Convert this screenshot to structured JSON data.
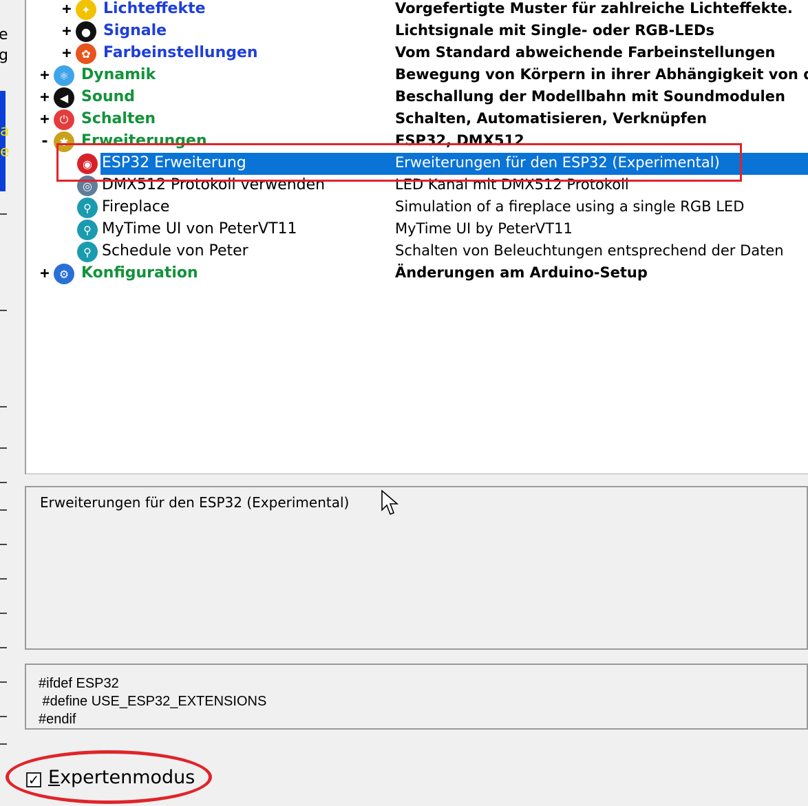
{
  "left_fragments": [
    "e",
    "g",
    "a",
    "e"
  ],
  "tree": {
    "rows": [
      {
        "expander": "+",
        "icon": "light-bulb-icon",
        "icon_color": "#f2c200",
        "icon_glyph": "✦",
        "name": "Lichteffekte",
        "name_style": "cat-blue",
        "desc": "Vorgefertigte Muster für zahlreiche Lichteffekte.",
        "desc_style": "bold-desc"
      },
      {
        "expander": "+",
        "icon": "signal-icon",
        "icon_color": "#111111",
        "icon_glyph": "●",
        "name": "Signale",
        "name_style": "cat-blue",
        "desc": "Lichtsignale mit Single- oder RGB-LEDs",
        "desc_style": "bold-desc"
      },
      {
        "expander": "+",
        "icon": "color-wheel-icon",
        "icon_color": "#e8541c",
        "icon_glyph": "✿",
        "name": "Farbeinstellungen",
        "name_style": "cat-blue",
        "desc": "Vom Standard abweichende Farbeinstellungen",
        "desc_style": "bold-desc"
      },
      {
        "expander": "+",
        "icon": "atom-icon",
        "icon_color": "#3fa4e8",
        "icon_glyph": "⚛",
        "name": "Dynamik",
        "name_style": "cat-green",
        "desc": "Bewegung von Körpern in ihrer Abhängigkeit von den",
        "desc_style": "bold-desc"
      },
      {
        "expander": "+",
        "icon": "speaker-icon",
        "icon_color": "#111111",
        "icon_glyph": "◀",
        "name": "Sound",
        "name_style": "cat-green",
        "desc": "Beschallung der Modellbahn mit Soundmodulen",
        "desc_style": "bold-desc"
      },
      {
        "expander": "+",
        "icon": "switch-icon",
        "icon_color": "#e43c3c",
        "icon_glyph": "⏻",
        "name": "Schalten",
        "name_style": "cat-green",
        "desc": "Schalten, Automatisieren, Verknüpfen",
        "desc_style": "bold-desc"
      },
      {
        "expander": "-",
        "icon": "puzzle-icon",
        "icon_color": "#c9a21b",
        "icon_glyph": "✱",
        "name": "Erweiterungen",
        "name_style": "cat-green",
        "desc": "ESP32, DMX512",
        "desc_style": "bold-desc"
      },
      {
        "expander": "",
        "icon": "esp32-icon",
        "icon_color": "#d8222a",
        "icon_glyph": "◉",
        "name": "ESP32 Erweiterung",
        "name_style": "white",
        "desc": "Erweiterungen für den ESP32 (Experimental)",
        "desc_style": "white",
        "selected": true
      },
      {
        "expander": "",
        "icon": "dmx-icon",
        "icon_color": "#607d9a",
        "icon_glyph": "◎",
        "name": "DMX512 Protokoll verwenden",
        "name_style": "plain",
        "desc": "LED Kanal mit DMX512 Protokoll",
        "desc_style": "plain"
      },
      {
        "expander": "",
        "icon": "search-teal-icon",
        "icon_color": "#1b9bb0",
        "icon_glyph": "⚲",
        "name": "Fireplace",
        "name_style": "plain",
        "desc": "Simulation of a fireplace using a single RGB LED",
        "desc_style": "plain"
      },
      {
        "expander": "",
        "icon": "search-teal-icon",
        "icon_color": "#1b9bb0",
        "icon_glyph": "⚲",
        "name": "MyTime UI von PeterVT11",
        "name_style": "plain",
        "desc": "MyTime UI by PeterVT11",
        "desc_style": "plain"
      },
      {
        "expander": "",
        "icon": "search-teal-icon",
        "icon_color": "#1b9bb0",
        "icon_glyph": "⚲",
        "name": "Schedule von Peter",
        "name_style": "plain",
        "desc": "Schalten von Beleuchtungen entsprechend der Daten",
        "desc_style": "plain"
      },
      {
        "expander": "+",
        "icon": "gear-icon",
        "icon_color": "#2a6fd6",
        "icon_glyph": "⚙",
        "name": "Konfiguration",
        "name_style": "cat-green",
        "desc": "Änderungen am Arduino-Setup",
        "desc_style": "bold-desc"
      }
    ]
  },
  "info": {
    "text": "Erweiterungen für den ESP32 (Experimental)"
  },
  "code": {
    "lines": [
      "#ifdef ESP32",
      " #define USE_ESP32_EXTENSIONS",
      "#endif"
    ]
  },
  "expert": {
    "checked_glyph": "✓",
    "label_first": "E",
    "label_rest": "xpertenmodus"
  },
  "colors": {
    "selection": "#0a73d6",
    "annotation_red": "#e0242a",
    "category_blue": "#1e3fd9",
    "category_green": "#13923a"
  }
}
